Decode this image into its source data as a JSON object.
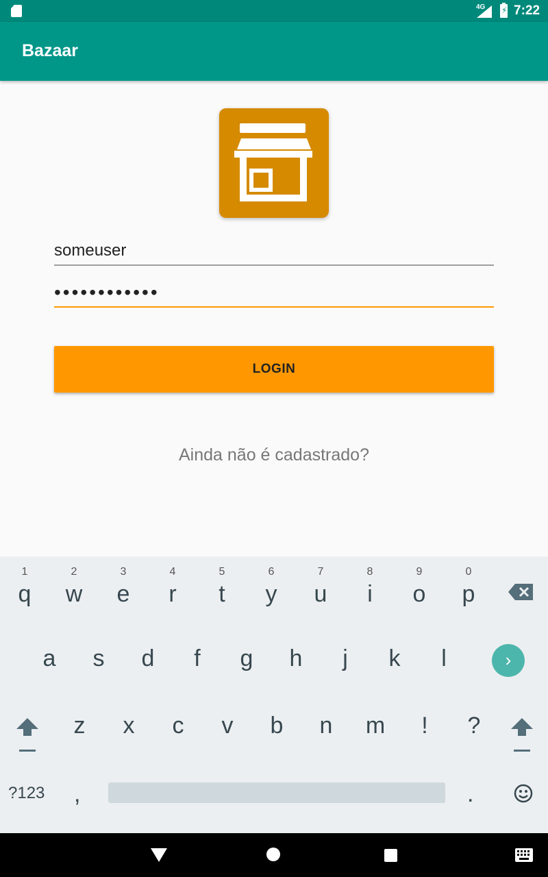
{
  "status_bar": {
    "time": "7:22",
    "network": "4G",
    "icons": [
      "sd-card-icon",
      "signal-icon",
      "battery-charging-icon"
    ]
  },
  "app_bar": {
    "title": "Bazaar"
  },
  "logo": {
    "icon": "storefront-icon",
    "color": "#d58a00"
  },
  "form": {
    "username_value": "someuser",
    "password_value": "••••••••••••",
    "login_label": "LOGIN",
    "signup_text": "Ainda não é cadastrado?"
  },
  "keyboard": {
    "row1": [
      {
        "k": "q",
        "h": "1"
      },
      {
        "k": "w",
        "h": "2"
      },
      {
        "k": "e",
        "h": "3"
      },
      {
        "k": "r",
        "h": "4"
      },
      {
        "k": "t",
        "h": "5"
      },
      {
        "k": "y",
        "h": "6"
      },
      {
        "k": "u",
        "h": "7"
      },
      {
        "k": "i",
        "h": "8"
      },
      {
        "k": "o",
        "h": "9"
      },
      {
        "k": "p",
        "h": "0"
      }
    ],
    "row2": [
      "a",
      "s",
      "d",
      "f",
      "g",
      "h",
      "j",
      "k",
      "l"
    ],
    "row3": [
      "z",
      "x",
      "c",
      "v",
      "b",
      "n",
      "m",
      "!",
      "?"
    ],
    "symbols_label": "?123",
    "comma": ",",
    "period": "."
  },
  "colors": {
    "status_bar": "#00897b",
    "app_bar": "#009688",
    "accent": "#ff9800",
    "enter_key": "#4db6ac"
  },
  "nav_bar": {
    "icons": [
      "back-icon",
      "home-icon",
      "recents-icon",
      "keyboard-icon"
    ]
  }
}
